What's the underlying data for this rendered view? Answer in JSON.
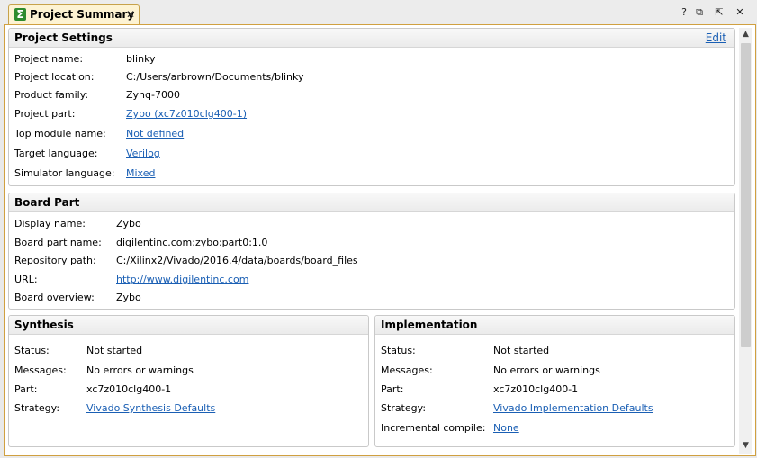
{
  "tab": {
    "title": "Project Summary",
    "close": "✕"
  },
  "window_buttons": {
    "help": "?",
    "restore": "⧉",
    "detach": "⇱",
    "close": "✕"
  },
  "project_settings": {
    "title": "Project Settings",
    "edit_label": "Edit",
    "rows": [
      {
        "label": "Project name:",
        "value": "blinky"
      },
      {
        "label": "Project location:",
        "value": "C:/Users/arbrown/Documents/blinky"
      },
      {
        "label": "Product family:",
        "value": "Zynq-7000"
      },
      {
        "label": "Project part:",
        "value": "Zybo (xc7z010clg400-1)"
      },
      {
        "label": "Top module name:",
        "value": "Not defined"
      },
      {
        "label": "Target language:",
        "value": "Verilog"
      },
      {
        "label": "Simulator language:",
        "value": "Mixed"
      }
    ]
  },
  "board_part": {
    "title": "Board Part",
    "rows": [
      {
        "label": "Display name:",
        "value": "Zybo"
      },
      {
        "label": "Board part name:",
        "value": "digilentinc.com:zybo:part0:1.0"
      },
      {
        "label": "Repository path:",
        "value": "C:/Xilinx2/Vivado/2016.4/data/boards/board_files"
      },
      {
        "label": "URL:",
        "value": "http://www.digilentinc.com"
      },
      {
        "label": "Board overview:",
        "value": "Zybo"
      }
    ]
  },
  "synthesis": {
    "title": "Synthesis",
    "rows": [
      {
        "label": "Status:",
        "value": "Not started"
      },
      {
        "label": "Messages:",
        "value": "No errors or warnings"
      },
      {
        "label": "Part:",
        "value": "xc7z010clg400-1"
      },
      {
        "label": "Strategy:",
        "value": "Vivado Synthesis Defaults"
      }
    ]
  },
  "implementation": {
    "title": "Implementation",
    "rows": [
      {
        "label": "Status:",
        "value": "Not started"
      },
      {
        "label": "Messages:",
        "value": "No errors or warnings"
      },
      {
        "label": "Part:",
        "value": "xc7z010clg400-1"
      },
      {
        "label": "Strategy:",
        "value": "Vivado Implementation Defaults"
      },
      {
        "label": "Incremental compile:",
        "value": "None"
      }
    ]
  },
  "scrollbar": {
    "up": "▲",
    "down": "▼"
  },
  "colors": {
    "link": "#1a5fb4",
    "tab_bg": "#fdf3d3",
    "frame_border": "#d0a040",
    "sigma_icon": "#2e8b2e"
  },
  "icons": {
    "tab": "sigma-icon"
  }
}
